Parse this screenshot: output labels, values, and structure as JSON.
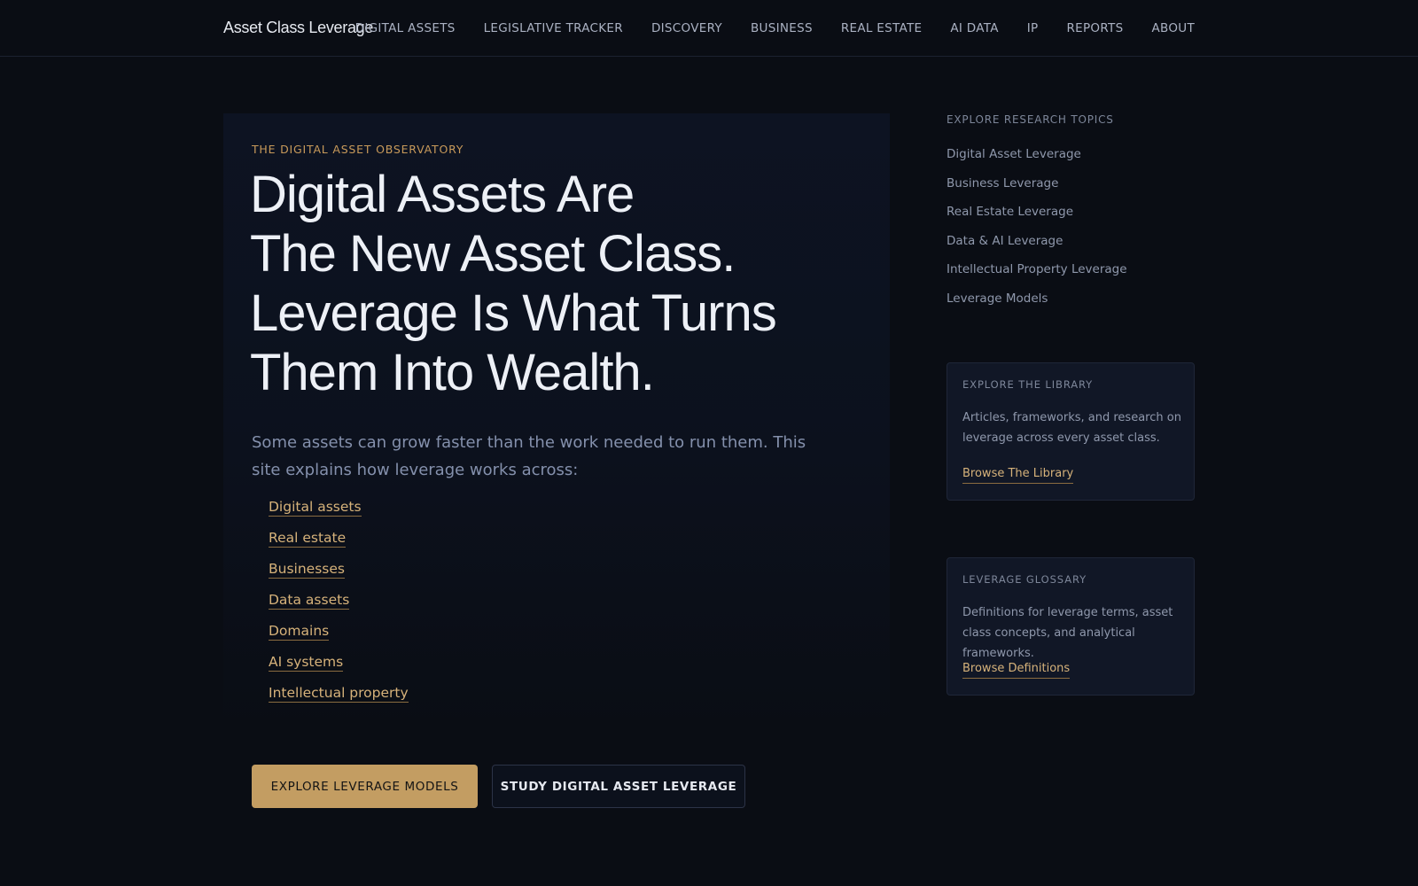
{
  "header": {
    "brand": "Asset Class Leverage",
    "nav": [
      "DIGITAL ASSETS",
      "LEGISLATIVE TRACKER",
      "DISCOVERY",
      "BUSINESS",
      "REAL ESTATE",
      "AI DATA",
      "IP",
      "REPORTS",
      "ABOUT"
    ]
  },
  "hero": {
    "eyebrow": "THE DIGITAL ASSET OBSERVATORY",
    "headline_lines": [
      "Digital Assets Are",
      "The New Asset Class.",
      "Leverage Is What Turns",
      "Them Into Wealth."
    ],
    "intro": "Some assets can grow faster than the work needed to run them. This site explains how leverage works across:",
    "links": [
      "Digital assets",
      "Real estate",
      "Businesses",
      "Data assets",
      "Domains",
      "AI systems",
      "Intellectual property"
    ],
    "primary_button": "EXPLORE LEVERAGE MODELS",
    "secondary_button": "STUDY DIGITAL ASSET LEVERAGE"
  },
  "sidebar": {
    "topics_title": "EXPLORE RESEARCH TOPICS",
    "topics": [
      "Digital Asset Leverage",
      "Business Leverage",
      "Real Estate Leverage",
      "Data & AI Leverage",
      "Intellectual Property Leverage",
      "Leverage Models"
    ],
    "library": {
      "title": "EXPLORE THE LIBRARY",
      "description": "Articles, frameworks, and research on leverage across every asset class.",
      "link": "Browse The Library"
    },
    "glossary": {
      "title": "LEVERAGE GLOSSARY",
      "description": "Definitions for leverage terms, asset class concepts, and analytical frameworks.",
      "link": "Browse Definitions"
    }
  },
  "colors": {
    "background": "#0a0d14",
    "accent": "#c39d62",
    "link": "#d6b27a"
  }
}
